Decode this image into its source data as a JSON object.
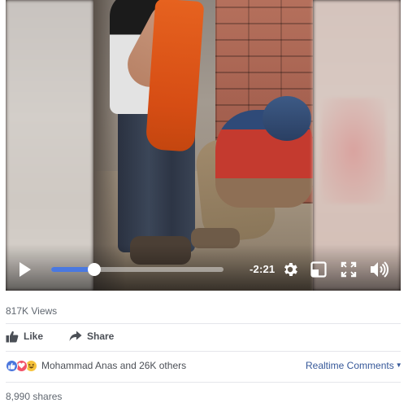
{
  "video": {
    "time_remaining": "-2:21",
    "progress_fraction": 0.25,
    "icons": {
      "play": "play-icon",
      "settings": "gear-icon",
      "pip": "picture-in-picture-icon",
      "fullscreen": "fullscreen-icon",
      "volume": "volume-icon"
    },
    "colors": {
      "progress": "#4a78e0"
    }
  },
  "stats": {
    "views": "817K Views",
    "reactions_text": "Mohammad Anas and 26K others",
    "shares": "8,990 shares"
  },
  "actions": {
    "like_label": "Like",
    "share_label": "Share"
  },
  "comments": {
    "mode_label": "Realtime Comments"
  }
}
